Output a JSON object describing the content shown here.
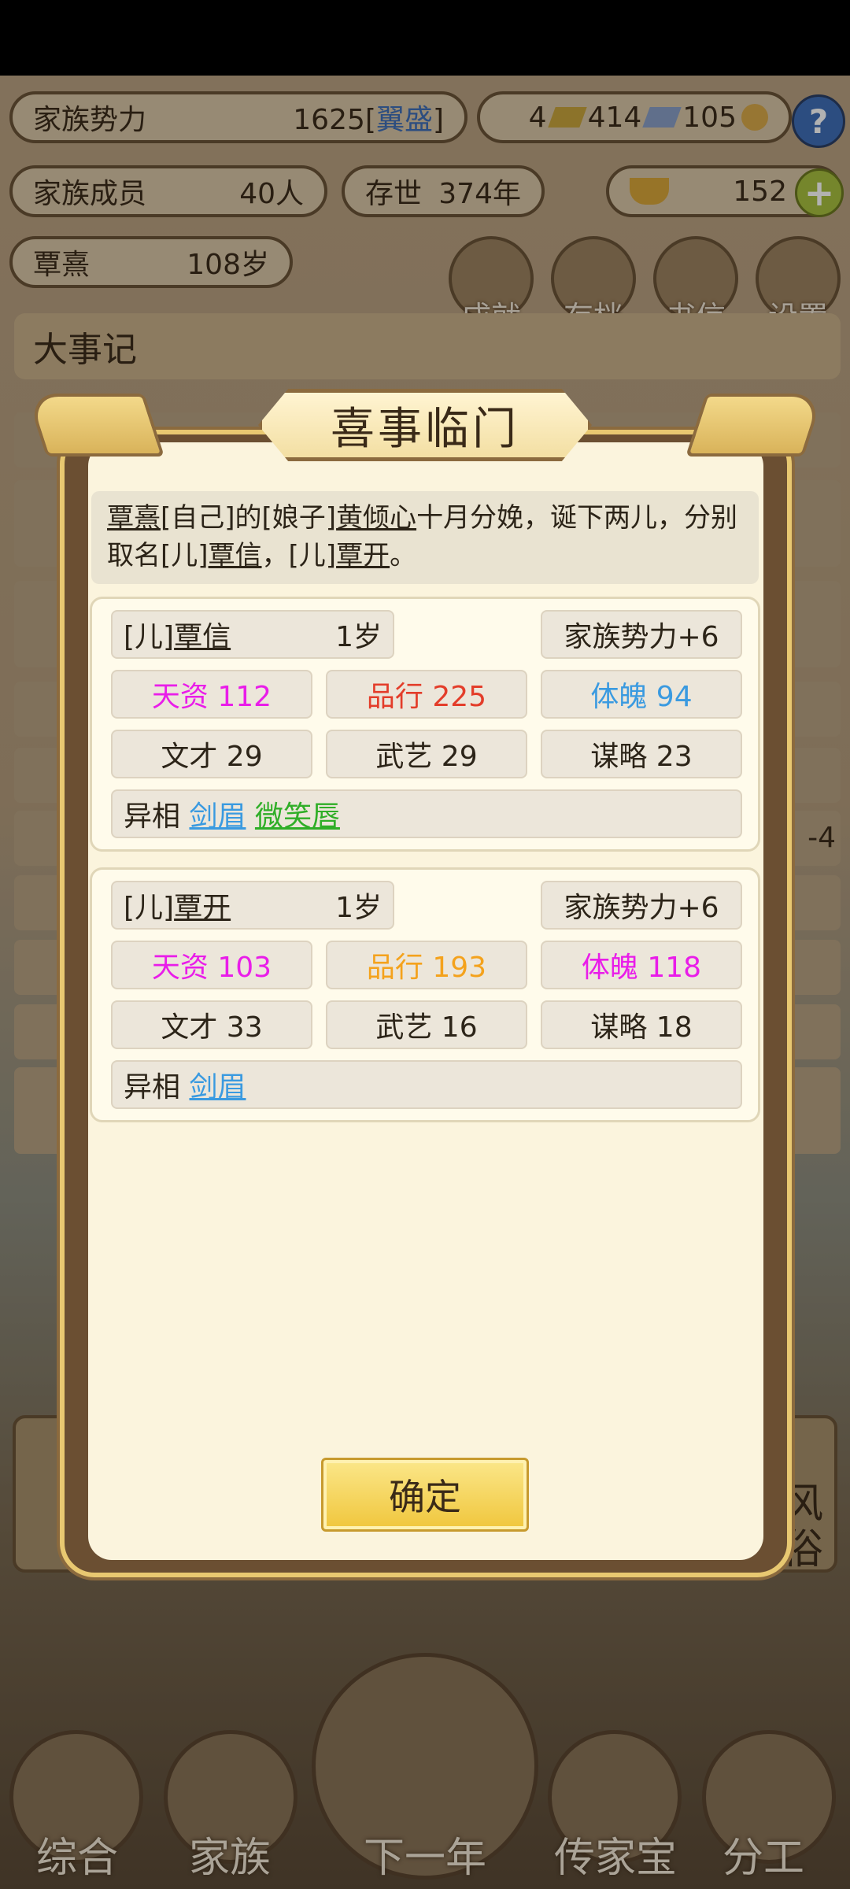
{
  "background": {
    "stats": {
      "family_power_label": "家族势力",
      "family_power_value": "1625[",
      "family_power_rank": "翼盛",
      "family_power_close": "]",
      "gold": "4",
      "silver": "414",
      "tickets": "105",
      "members_label": "家族成员",
      "members_value": "40人",
      "existence_label": "存世",
      "existence_value": "374年",
      "ingot_value": "152",
      "elder_name": "覃熹",
      "elder_age": "108岁"
    },
    "icon_buttons": [
      "成就",
      "存档",
      "书信",
      "设置"
    ],
    "chronicle_title": "大事记",
    "right_tile_label_1": "风",
    "right_tile_label_2": "俗",
    "log_side_text": "-4",
    "bottom_nav": [
      "综合",
      "家族",
      "下一年",
      "传家宝",
      "分工"
    ]
  },
  "modal": {
    "title": "喜事临门",
    "message": {
      "p1": "覃熹",
      "p2": "[自己]的[娘子]",
      "p3": "黄倾心",
      "p4": "十月分娩，诞下两儿，分别取名[儿]",
      "p5": "覃信",
      "p6": "，[儿]",
      "p7": "覃开",
      "p8": "。"
    },
    "children": [
      {
        "prefix": "[儿]",
        "name": "覃信",
        "age": "1岁",
        "power": "家族势力+6",
        "talent": "天资 112",
        "conduct": "品行 225",
        "physique": "体魄 94",
        "literary": "文才 29",
        "martial": "武艺 29",
        "strategy": "谋略 23",
        "traits_label": "异相",
        "traits": [
          "剑眉",
          "微笑唇"
        ]
      },
      {
        "prefix": "[儿]",
        "name": "覃开",
        "age": "1岁",
        "power": "家族势力+6",
        "talent": "天资 103",
        "conduct": "品行 193",
        "physique": "体魄 118",
        "literary": "文才 33",
        "martial": "武艺 16",
        "strategy": "谋略 18",
        "traits_label": "异相",
        "traits": [
          "剑眉"
        ]
      }
    ],
    "confirm_label": "确定"
  },
  "colors": {
    "talent": "#e91de9",
    "conduct_high": "#e33d2a",
    "conduct_mid": "#f4a21c",
    "physique_low": "#3a9ae0",
    "physique_high": "#e91de9",
    "trait_blue": "#3a9ae0",
    "trait_green": "#2fae27"
  }
}
